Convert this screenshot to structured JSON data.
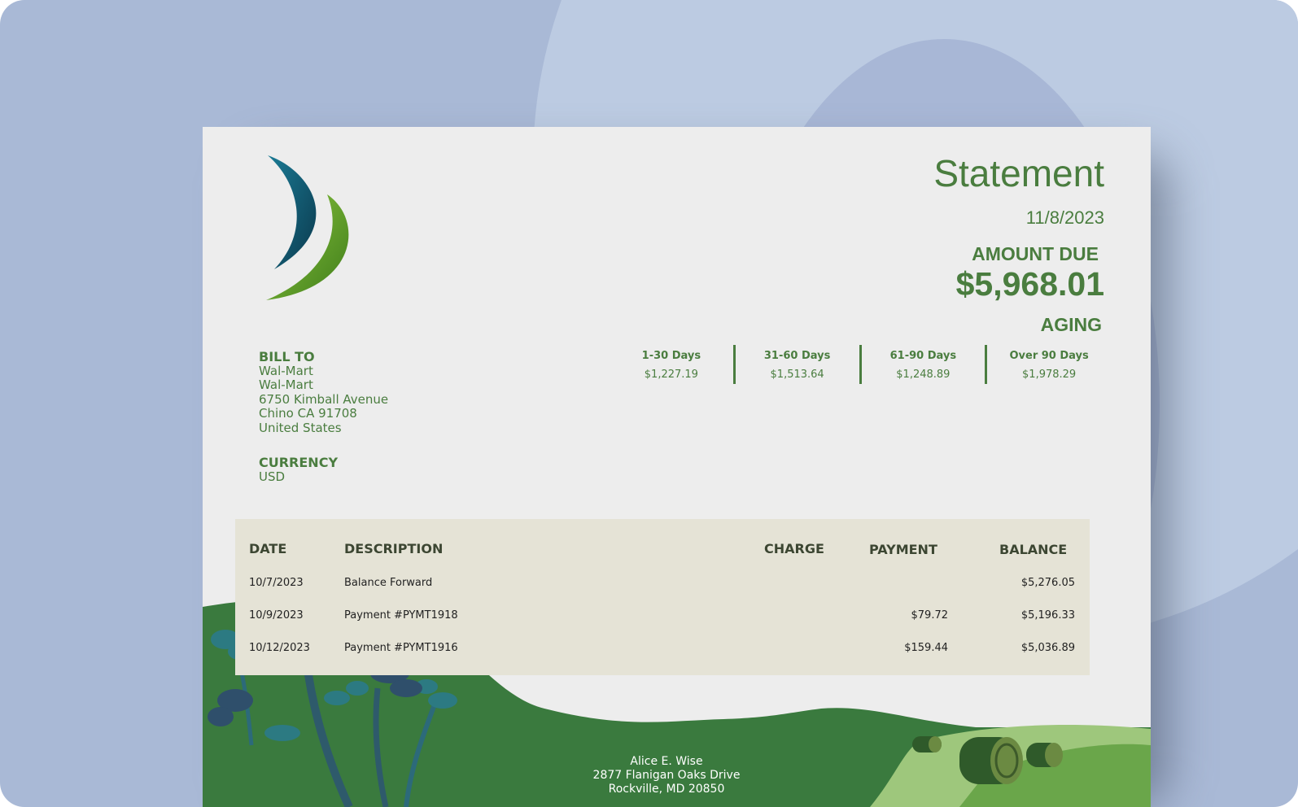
{
  "document": {
    "title": "Statement",
    "date": "11/8/2023",
    "amount_due_label": "AMOUNT DUE",
    "amount_due": "$5,968.01",
    "aging_label": "AGING"
  },
  "aging": [
    {
      "label": "1-30 Days",
      "value": "$1,227.19"
    },
    {
      "label": "31-60 Days",
      "value": "$1,513.64"
    },
    {
      "label": "61-90 Days",
      "value": "$1,248.89"
    },
    {
      "label": "Over 90 Days",
      "value": "$1,978.29"
    }
  ],
  "bill_to": {
    "label": "BILL TO",
    "lines": [
      "Wal-Mart",
      "Wal-Mart",
      "6750 Kimball Avenue",
      "Chino CA 91708",
      "United States"
    ]
  },
  "currency": {
    "label": "CURRENCY",
    "value": "USD"
  },
  "table": {
    "headers": {
      "date": "DATE",
      "description": "DESCRIPTION",
      "charge": "CHARGE",
      "payment": "PAYMENT",
      "balance": "BALANCE"
    },
    "rows": [
      {
        "date": "10/7/2023",
        "description": "Balance Forward",
        "charge": "",
        "payment": "",
        "balance": "$5,276.05"
      },
      {
        "date": "10/9/2023",
        "description": "Payment #PYMT1918",
        "charge": "",
        "payment": "$79.72",
        "balance": "$5,196.33"
      },
      {
        "date": "10/12/2023",
        "description": "Payment #PYMT1916",
        "charge": "",
        "payment": "$159.44",
        "balance": "$5,036.89"
      }
    ]
  },
  "footer": {
    "name": "Alice E. Wise",
    "street": "2877 Flanigan Oaks Drive",
    "city": "Rockville, MD 20850"
  },
  "colors": {
    "accent_green": "#4a7d3f",
    "table_bg": "#e5e3d6",
    "hill_dark": "#3a7a3e",
    "hill_light": "#8bc06a"
  }
}
